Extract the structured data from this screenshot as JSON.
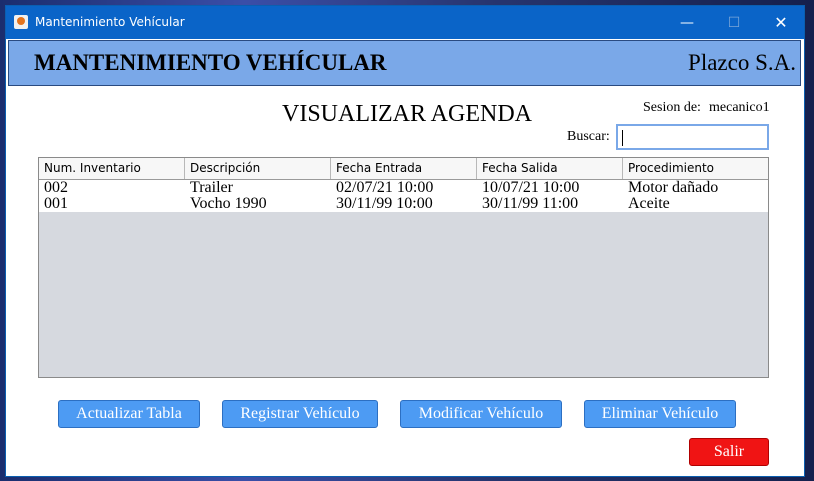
{
  "window": {
    "title": "Mantenimiento Vehícular",
    "controls": {
      "minimize": "—",
      "maximize": "☐",
      "close": "✕"
    }
  },
  "header": {
    "title": "MANTENIMIENTO VEHÍCULAR",
    "company": "Plazco S.A."
  },
  "page": {
    "heading": "VISUALIZAR AGENDA",
    "session_label": "Sesion de:",
    "session_user": "mecanico1",
    "search_label": "Buscar:",
    "search_value": ""
  },
  "table": {
    "columns": [
      "Num. Inventario",
      "Descripción",
      "Fecha Entrada",
      "Fecha Salida",
      "Procedimiento"
    ],
    "rows": [
      [
        "002",
        "Trailer",
        "02/07/21 10:00",
        "10/07/21 10:00",
        "Motor dañado"
      ],
      [
        "001",
        "Vocho 1990",
        "30/11/99 10:00",
        "30/11/99 11:00",
        "Aceite"
      ]
    ]
  },
  "buttons": {
    "refresh": "Actualizar Tabla",
    "register": "Registrar Vehículo",
    "modify": "Modificar Vehículo",
    "delete": "Eliminar Vehículo",
    "exit": "Salir"
  },
  "colors": {
    "titlebar": "#0a64c8",
    "header_band": "#7aa8e8",
    "button": "#4d9bf3",
    "exit_button": "#f01414"
  }
}
